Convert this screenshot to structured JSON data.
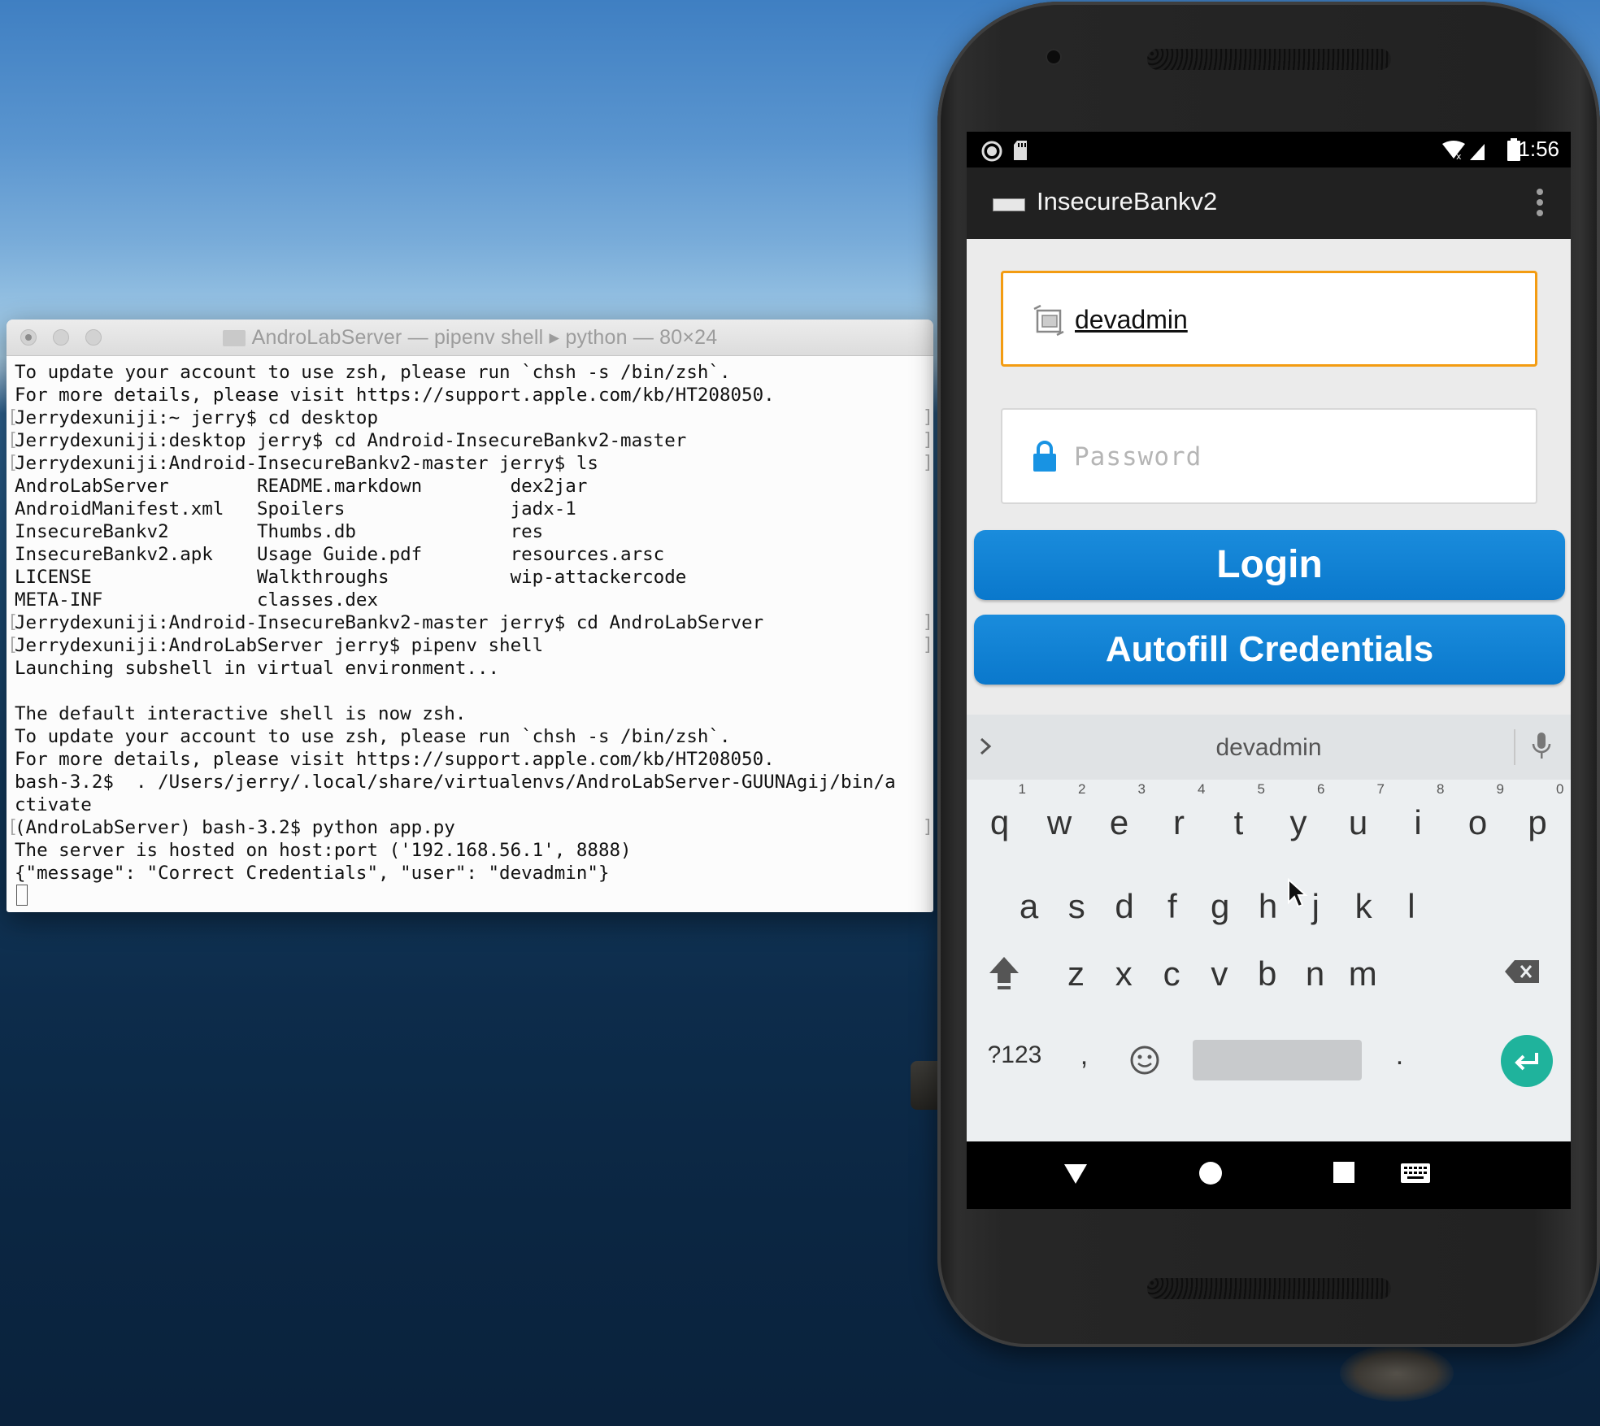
{
  "terminal": {
    "title": "AndroLabServer — pipenv shell ▸ python — 80×24",
    "lines": [
      "To update your account to use zsh, please run `chsh -s /bin/zsh`.",
      "For more details, please visit https://support.apple.com/kb/HT208050.",
      "Jerrydexuniji:~ jerry$ cd desktop",
      "Jerrydexuniji:desktop jerry$ cd Android-InsecureBankv2-master",
      "Jerrydexuniji:Android-InsecureBankv2-master jerry$ ls",
      "AndroLabServer        README.markdown        dex2jar",
      "AndroidManifest.xml   Spoilers               jadx-1",
      "InsecureBankv2        Thumbs.db              res",
      "InsecureBankv2.apk    Usage Guide.pdf        resources.arsc",
      "LICENSE               Walkthroughs           wip-attackercode",
      "META-INF              classes.dex",
      "Jerrydexuniji:Android-InsecureBankv2-master jerry$ cd AndroLabServer",
      "Jerrydexuniji:AndroLabServer jerry$ pipenv shell",
      "Launching subshell in virtual environment...",
      "",
      "The default interactive shell is now zsh.",
      "To update your account to use zsh, please run `chsh -s /bin/zsh`.",
      "For more details, please visit https://support.apple.com/kb/HT208050.",
      "bash-3.2$  . /Users/jerry/.local/share/virtualenvs/AndroLabServer-GUUNAgij/bin/a",
      "ctivate",
      "(AndroLabServer) bash-3.2$ python app.py",
      "The server is hosted on host:port ('192.168.56.1', 8888)",
      "{\"message\": \"Correct Credentials\", \"user\": \"devadmin\"}"
    ]
  },
  "phone": {
    "status": {
      "time": "1:56"
    },
    "app": {
      "title": "InsecureBankv2"
    },
    "login": {
      "username_value": "devadmin",
      "password_placeholder": "Password",
      "login_label": "Login",
      "autofill_label": "Autofill Credentials"
    },
    "keyboard": {
      "suggestion": "devadmin",
      "row1": [
        {
          "k": "q",
          "n": "1"
        },
        {
          "k": "w",
          "n": "2"
        },
        {
          "k": "e",
          "n": "3"
        },
        {
          "k": "r",
          "n": "4"
        },
        {
          "k": "t",
          "n": "5"
        },
        {
          "k": "y",
          "n": "6"
        },
        {
          "k": "u",
          "n": "7"
        },
        {
          "k": "i",
          "n": "8"
        },
        {
          "k": "o",
          "n": "9"
        },
        {
          "k": "p",
          "n": "0"
        }
      ],
      "row2": [
        "a",
        "s",
        "d",
        "f",
        "g",
        "h",
        "j",
        "k",
        "l"
      ],
      "row3": [
        "z",
        "x",
        "c",
        "v",
        "b",
        "n",
        "m"
      ],
      "symbols_label": "?123",
      "comma": ",",
      "period": "."
    },
    "colors": {
      "accent_blue": "#0a78cc",
      "focus_orange": "#f39c12",
      "enter_teal": "#1fb39c"
    }
  }
}
